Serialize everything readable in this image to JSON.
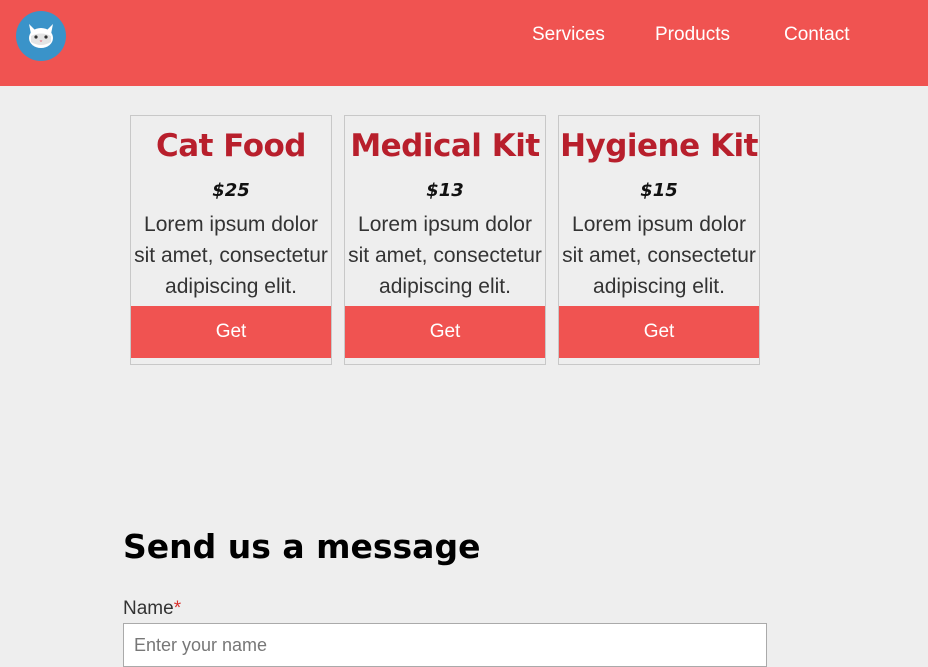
{
  "header": {
    "logo_icon": "cat-face-icon",
    "nav": [
      {
        "label": "Services"
      },
      {
        "label": "Products"
      },
      {
        "label": "Contact"
      }
    ],
    "background_color": "#f05351"
  },
  "products": [
    {
      "title": "Cat Food",
      "price": "$25",
      "description": "Lorem ipsum dolor sit amet, consectetur adipiscing elit.",
      "button_label": "Get"
    },
    {
      "title": "Medical Kit",
      "price": "$13",
      "description": "Lorem ipsum dolor sit amet, consectetur adipiscing elit.",
      "button_label": "Get"
    },
    {
      "title": "Hygiene Kit",
      "price": "$15",
      "description": "Lorem ipsum dolor sit amet, consectetur adipiscing elit.",
      "button_label": "Get"
    }
  ],
  "contact": {
    "heading": "Send us a message",
    "name_label": "Name",
    "required_mark": "*",
    "name_placeholder": "Enter your name",
    "name_value": ""
  },
  "colors": {
    "accent": "#f05351",
    "title_red": "#b81f2c",
    "logo_blue": "#3a93c9"
  }
}
